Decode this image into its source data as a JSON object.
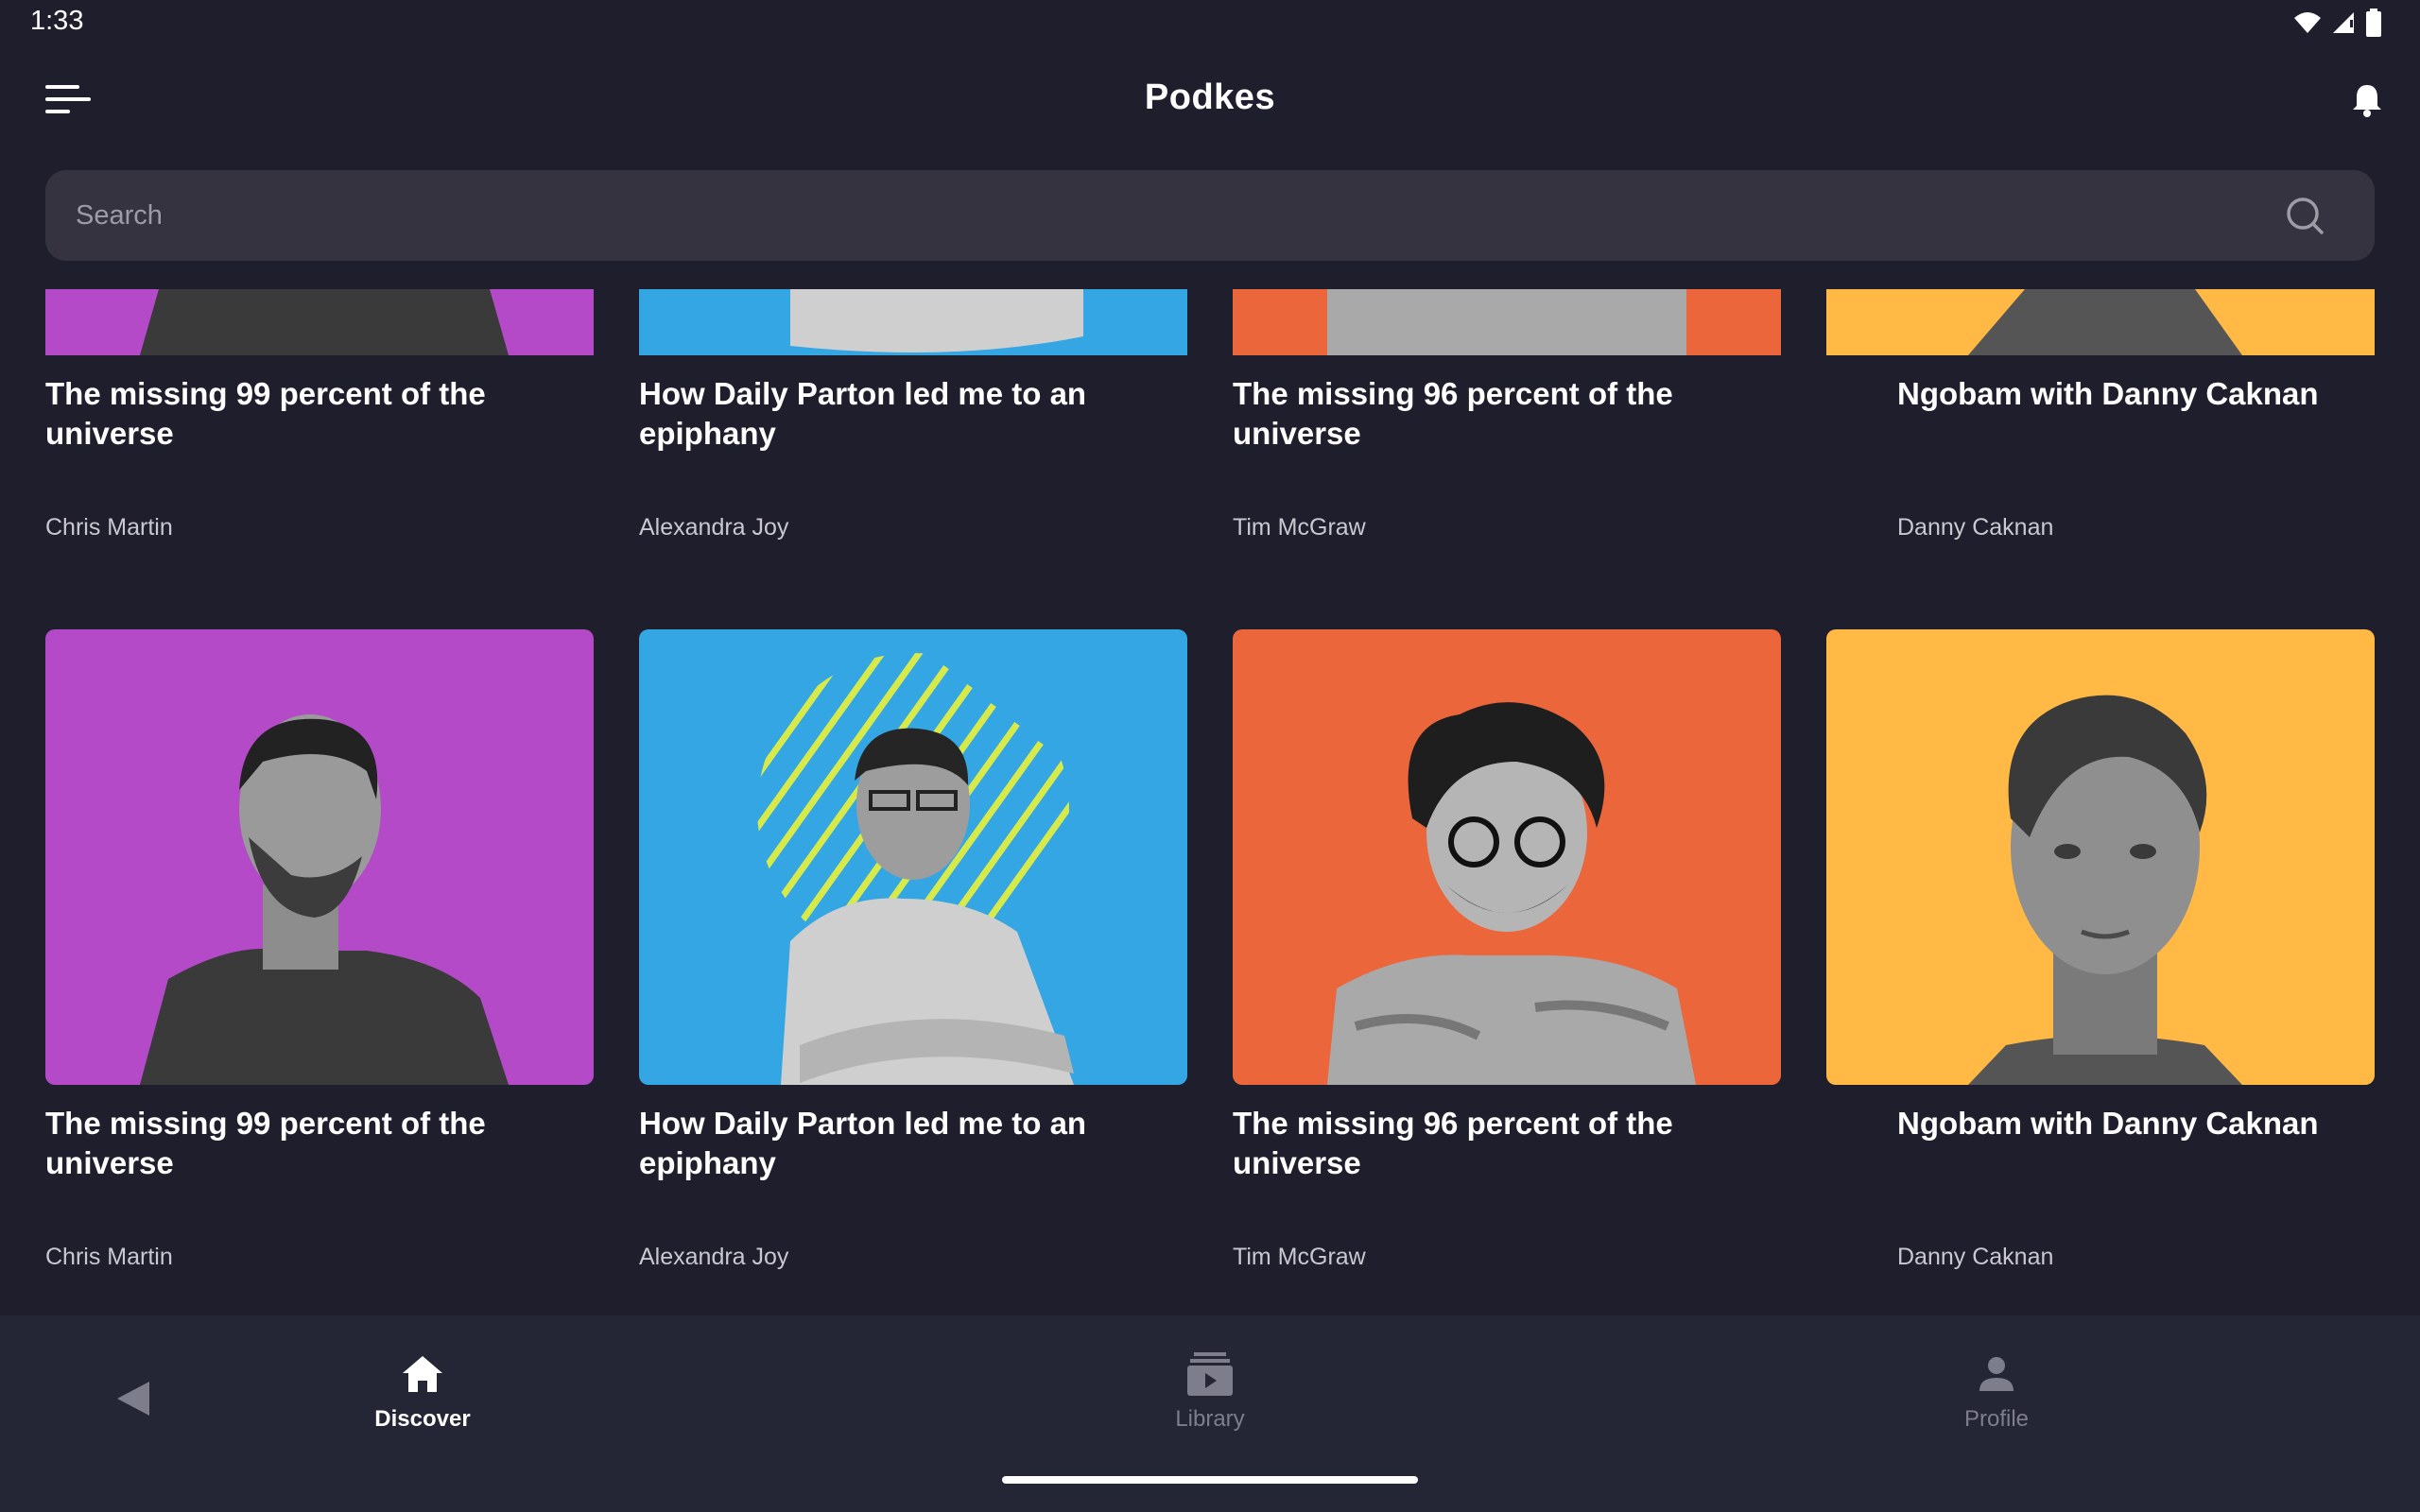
{
  "status_bar": {
    "time": "1:33"
  },
  "app_bar": {
    "title": "Podkes"
  },
  "search": {
    "placeholder": "Search"
  },
  "cards_row1": [
    {
      "title": "The missing 99 percent of the universe",
      "author": "Chris Martin",
      "color": "#b44ac8"
    },
    {
      "title": "How Daily Parton led me to an epiphany",
      "author": "Alexandra Joy",
      "color": "#34a6e3"
    },
    {
      "title": "The missing 96 percent of the universe",
      "author": "Tim McGraw",
      "color": "#ec663b"
    },
    {
      "title": "Ngobam with Danny Caknan",
      "author": "Danny Caknan",
      "color": "#ffb944"
    }
  ],
  "cards_row2": [
    {
      "title": "The missing 99 percent of the universe",
      "author": "Chris Martin",
      "color": "#b44ac8"
    },
    {
      "title": "How Daily Parton led me to an epiphany",
      "author": "Alexandra Joy",
      "color": "#34a6e3"
    },
    {
      "title": "The missing 96 percent of the universe",
      "author": "Tim McGraw",
      "color": "#ec663b"
    },
    {
      "title": "Ngobam with Danny Caknan",
      "author": "Danny Caknan",
      "color": "#ffb944"
    }
  ],
  "bottom_nav": {
    "items": [
      {
        "label": "Discover",
        "icon": "home-icon",
        "active": true
      },
      {
        "label": "Library",
        "icon": "library-icon",
        "active": false
      },
      {
        "label": "Profile",
        "icon": "person-icon",
        "active": false
      }
    ]
  },
  "colors": {
    "background": "#1f1e2d",
    "search_bg": "#34333f",
    "nav_bg": "#242535",
    "inactive": "#7d7d8c"
  }
}
